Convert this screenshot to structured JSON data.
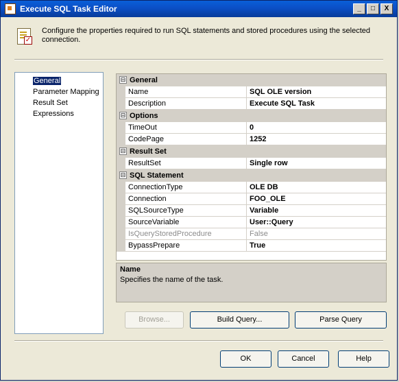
{
  "window": {
    "title": "Execute SQL Task Editor",
    "buttons": {
      "minimize": "_",
      "maximize": "□",
      "close": "X"
    }
  },
  "header": {
    "text": "Configure the properties required to run SQL statements and stored procedures using the selected connection."
  },
  "nav": {
    "items": [
      {
        "label": "General",
        "selected": true
      },
      {
        "label": "Parameter Mapping"
      },
      {
        "label": "Result Set"
      },
      {
        "label": "Expressions"
      }
    ]
  },
  "grid": {
    "categories": [
      {
        "name": "General",
        "props": [
          {
            "name": "Name",
            "value": "SQL OLE version"
          },
          {
            "name": "Description",
            "value": "Execute SQL Task"
          }
        ]
      },
      {
        "name": "Options",
        "props": [
          {
            "name": "TimeOut",
            "value": "0"
          },
          {
            "name": "CodePage",
            "value": "1252"
          }
        ]
      },
      {
        "name": "Result Set",
        "props": [
          {
            "name": "ResultSet",
            "value": "Single row"
          }
        ]
      },
      {
        "name": "SQL Statement",
        "props": [
          {
            "name": "ConnectionType",
            "value": "OLE DB"
          },
          {
            "name": "Connection",
            "value": "FOO_OLE"
          },
          {
            "name": "SQLSourceType",
            "value": "Variable"
          },
          {
            "name": "SourceVariable",
            "value": "User::Query"
          },
          {
            "name": "IsQueryStoredProcedure",
            "value": "False",
            "disabled": true
          },
          {
            "name": "BypassPrepare",
            "value": "True"
          }
        ]
      }
    ],
    "collapse_glyph": "⊟"
  },
  "description": {
    "title": "Name",
    "text": "Specifies the name of the task."
  },
  "actions": {
    "browse": "Browse...",
    "build_query": "Build Query...",
    "parse_query": "Parse Query"
  },
  "footer": {
    "ok": "OK",
    "cancel": "Cancel",
    "help": "Help"
  }
}
